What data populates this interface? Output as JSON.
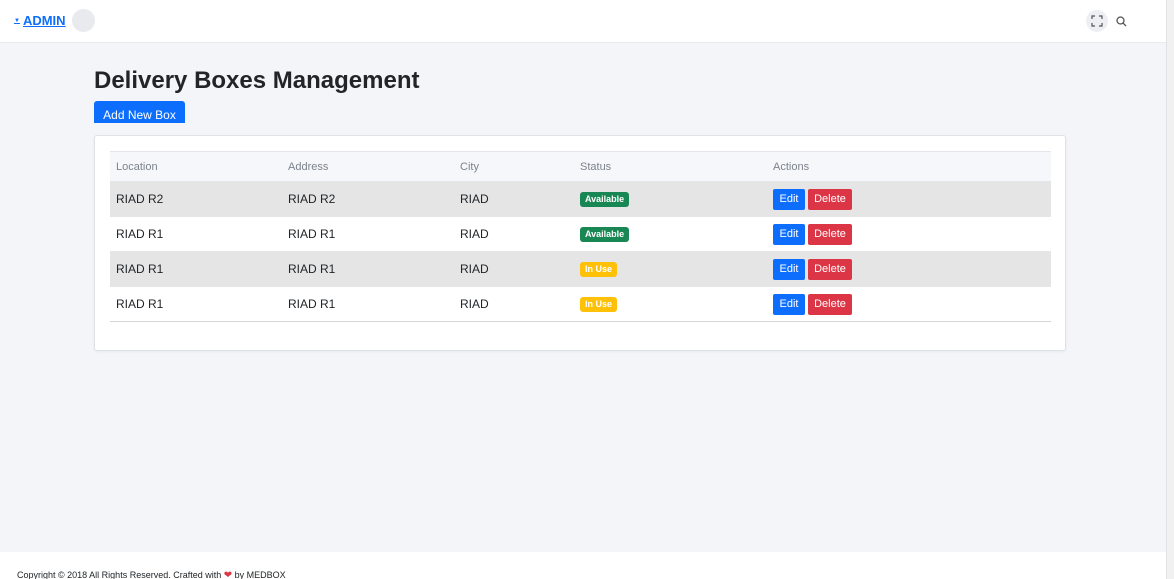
{
  "header": {
    "user_label": "ADMIN"
  },
  "page": {
    "title": "Delivery Boxes Management",
    "add_button_label": "Add New Box"
  },
  "table": {
    "columns": [
      "Location",
      "Address",
      "City",
      "Status",
      "Actions"
    ],
    "rows": [
      {
        "location": "RIAD R2",
        "address": "RIAD R2",
        "city": "RIAD",
        "status": "Available",
        "edit": "Edit",
        "delete": "Delete"
      },
      {
        "location": "RIAD R1",
        "address": "RIAD R1",
        "city": "RIAD",
        "status": "Available",
        "edit": "Edit",
        "delete": "Delete"
      },
      {
        "location": "RIAD R1",
        "address": "RIAD R1",
        "city": "RIAD",
        "status": "In Use",
        "edit": "Edit",
        "delete": "Delete"
      },
      {
        "location": "RIAD R1",
        "address": "RIAD R1",
        "city": "RIAD",
        "status": "In Use",
        "edit": "Edit",
        "delete": "Delete"
      }
    ]
  },
  "footer": {
    "text_before": "Copyright © 2018 All Rights Reserved. Crafted with ",
    "text_after": " by MEDBOX"
  },
  "colors": {
    "primary": "#0d6efd",
    "success": "#198754",
    "warning": "#ffc107",
    "danger": "#dc3545"
  }
}
